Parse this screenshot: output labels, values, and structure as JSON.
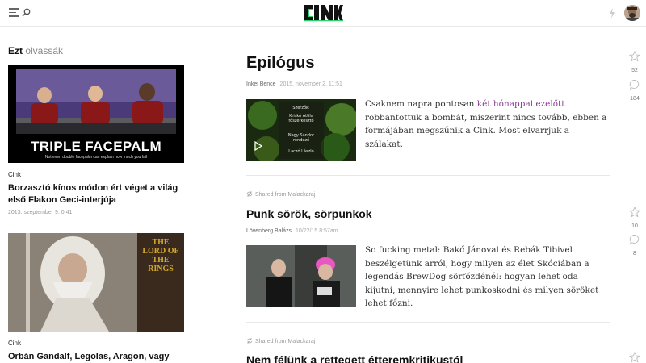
{
  "brand": {
    "logo_text": "CINK"
  },
  "header": {
    "menu_icon": "menu-icon",
    "search_icon": "search-icon",
    "bolt_icon": "bolt-icon"
  },
  "sidebar": {
    "title_bold": "Ezt",
    "title_rest": "olvassák",
    "cards": [
      {
        "image_caption": "TRIPLE FACEPALM",
        "image_subcaption": "Not even double facepalm can explain how much you fail",
        "category": "Cink",
        "headline": "Borzasztó kínos módon ért véget a világ első Flakon Geci-interjúja",
        "date": "2013. szeptember 9. 0:41"
      },
      {
        "image_caption": "THE LORD OF THE RINGS",
        "category": "Cink",
        "headline": "Orbán Gandalf, Legolas, Aragon, vagy Gimli, a"
      }
    ]
  },
  "posts": [
    {
      "title": "Epilógus",
      "author": "Inkei Bence",
      "date": "2015. november 2. 11:51",
      "excerpt_before": "Csaknem napra pontosan ",
      "excerpt_link": "két hónappal ezelőtt",
      "excerpt_after": " robbantottuk a bombát, miszerint nincs tovább, ebben a formájában megszűnik a Cink. Most elvarrjuk a szálakat.",
      "likes": "52",
      "comments": "184"
    },
    {
      "shared": "Shared from Malackaraj",
      "title": "Punk sörök, sörpunkok",
      "author": "Lövenberg Balázs",
      "date": "10/22/15 8:57am",
      "excerpt": "So fucking metal: Bakó Jánoval és Rebák Tibivel beszélgetünk arról, hogy milyen az élet Skóciában a legendás BrewDog sörfőzdénél: hogyan lehet oda kijutni, mennyire lehet punkoskodni és milyen söröket lehet főzni.",
      "likes": "10",
      "comments": "8"
    },
    {
      "shared": "Shared from Malackaraj",
      "title": "Nem félünk a rettegett étteremkritikustól"
    }
  ],
  "colors": {
    "link": "#8a3f8f",
    "divider": "#e8e8e8",
    "logo": "#111111"
  }
}
